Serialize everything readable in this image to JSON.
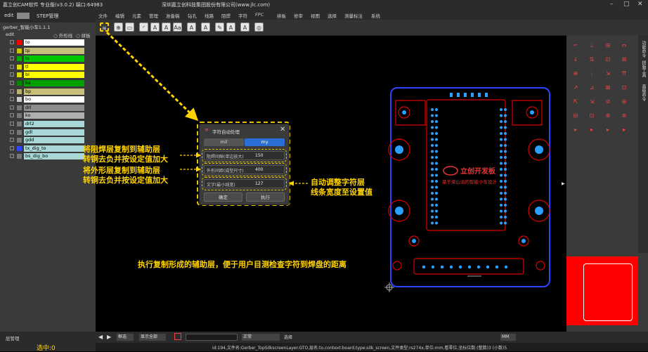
{
  "window": {
    "title": "嘉立创CAM软件 专业版(v3.0.2) 端口:64983",
    "company": "深圳嘉立创科技集团股份有限公司(www.jlc.com)"
  },
  "menu": [
    "文件",
    "编辑",
    "元素",
    "管理",
    "准备稿",
    "钻孔",
    "线路",
    "阻焊",
    "字符",
    "FPC",
    "拼板",
    "修审",
    "视图",
    "选择",
    "测量标注",
    "系统"
  ],
  "left_tabs": {
    "tab1": "edit",
    "tab2": "STEP管理"
  },
  "job": {
    "name": "gerber_智能小车1.1.1"
  },
  "step": {
    "name": "edit",
    "opt1": "外形线",
    "opt2": "拼板"
  },
  "layers": [
    {
      "name": "to",
      "color": "#ff0000",
      "bg": "#ffffff"
    },
    {
      "name": "tp",
      "color": "#c8c400",
      "bg": "#c8c07a"
    },
    {
      "name": "ts",
      "color": "#00aa00",
      "bg": "#00c800"
    },
    {
      "name": "tl",
      "color": "#dddd00",
      "bg": "#ffff00"
    },
    {
      "name": "bl",
      "color": "#dddd00",
      "bg": "#ffff00"
    },
    {
      "name": "bs",
      "color": "#008800",
      "bg": "#00a000"
    },
    {
      "name": "bp",
      "color": "#b8b070",
      "bg": "#c8c07a"
    },
    {
      "name": "bo",
      "color": "#cccccc",
      "bg": "#ffffff"
    },
    {
      "name": "drl",
      "color": "#777777",
      "bg": "#8c8c8c"
    },
    {
      "name": "ko",
      "color": "#777777",
      "bg": "#b0b0b0"
    },
    {
      "name": "drl2",
      "color": "#777777",
      "bg": "#a8d8d8"
    },
    {
      "name": "gdl",
      "color": "#777777",
      "bg": "#a8d8d8"
    },
    {
      "name": "gdd",
      "color": "#777777",
      "bg": "#a8d8d8"
    },
    {
      "name": "tx_dig_to",
      "color": "#3344ff",
      "bg": "#a8d8d8"
    },
    {
      "name": "bs_dig_bo",
      "color": "#777777",
      "bg": "#a8d8d8"
    }
  ],
  "dialog": {
    "title": "字符自动处理",
    "tab_mil": "mil",
    "tab_my": "my",
    "field1_label": "阻焊间隙(单边放大)",
    "field1_value": "150",
    "field2_label": "外形间距(成型尺寸)",
    "field2_value": "400",
    "field3_label": "文字(最小线宽)",
    "field3_value": "127",
    "btn_ok": "确定",
    "btn_run": "执行"
  },
  "annotations": {
    "a1_line1": "将阻焊层复制到辅助层",
    "a1_line2": "转铜去负并按设定值加大",
    "a2_line1": "将外形层复制到辅助层",
    "a2_line2": "转铜去负并按设定值加大",
    "a3_line1": "自动调整字符层",
    "a3_line2": "线条宽度至设置值",
    "a4": "执行复制形成的辅助层，便于用户目测检查字符到焊盘的距离"
  },
  "board": {
    "logo": "立创开发板",
    "sub": "基于梁山派的智能小车设计"
  },
  "right_tabs": [
    "功能命令",
    "拼版工具",
    "高级命令"
  ],
  "bottom": {
    "mode": "框选",
    "display_btn": "显示全部",
    "normal": "正常",
    "select_all": "选择",
    "unit": "MM",
    "layer_mgr": "层管理",
    "selected": "选中:0"
  },
  "status": "id:194,文件名:Gerber_TopSilkscreenLayer.GTO,层名:to,context:board,type:silk_screen,文件类型:rs274x,单位:mm,看零位,坐标位数:(整数)3 (小数)5"
}
